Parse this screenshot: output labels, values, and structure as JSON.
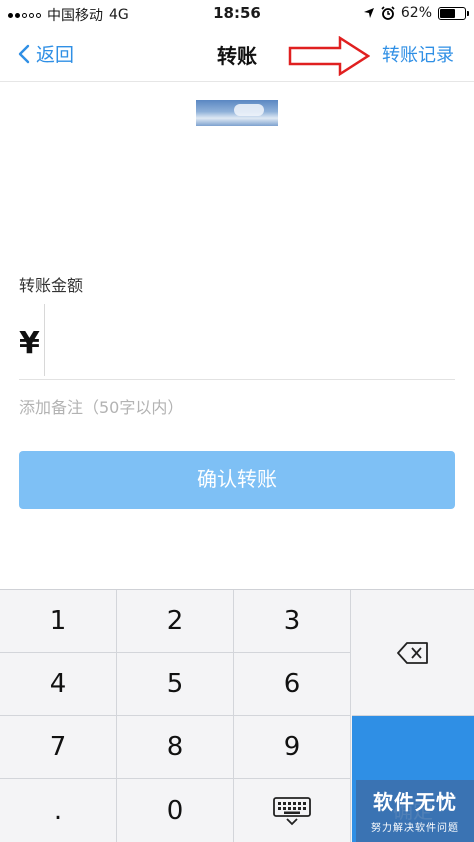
{
  "status_bar": {
    "carrier": "中国移动",
    "network": "4G",
    "time": "18:56",
    "battery": "62%",
    "battery_level": 0.62,
    "icons": [
      "location-arrow-icon",
      "alarm-icon",
      "battery-icon"
    ]
  },
  "nav": {
    "back_label": "返回",
    "title": "转账",
    "record_label": "转账记录"
  },
  "form": {
    "amount_label": "转账金额",
    "currency_symbol": "¥",
    "amount_value": "",
    "remark_placeholder": "添加备注（50字以内）",
    "confirm_label": "确认转账"
  },
  "keyboard": {
    "keys": [
      "1",
      "2",
      "3",
      "4",
      "5",
      "6",
      "7",
      "8",
      "9",
      ".",
      "0"
    ],
    "ok_label": "确定",
    "icons": [
      "backspace-icon",
      "keyboard-hide-icon"
    ]
  },
  "watermark": {
    "title": "软件无忧",
    "subtitle": "努力解决软件问题"
  },
  "colors": {
    "accent": "#2f8fe5",
    "button_disabled": "#7ec0f5",
    "annotation_arrow": "#e02020"
  }
}
